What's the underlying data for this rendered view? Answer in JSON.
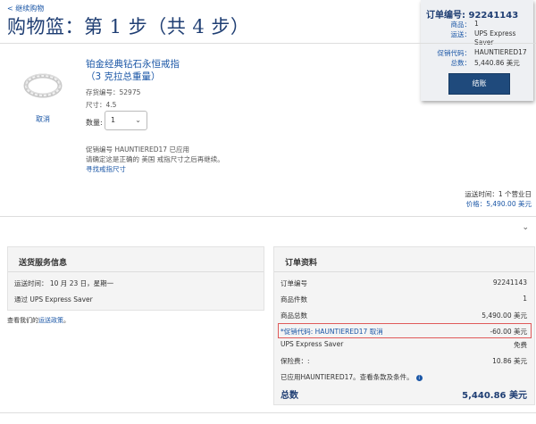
{
  "nav": {
    "back": "< 继续购物"
  },
  "page": {
    "title": "购物篮：第 1 步（共 4 步）"
  },
  "order_box": {
    "order_no_label": "订单编号:",
    "order_no": "92241143",
    "items_label": "商品：",
    "items": "1",
    "shipping_label": "运送：",
    "shipping": "UPS Express Saver",
    "promo_label": "促销代码：",
    "promo": "HAUNTIERED17",
    "total_label": "总数：",
    "total": "5,440.86 美元",
    "checkout": "结账"
  },
  "item": {
    "name_line1": "铂金经典钻石永恒戒指",
    "name_line2": "（3 克拉总重量）",
    "sku": "存货编号：52975",
    "size": "尺寸：4.5",
    "remove": "取消",
    "qty_label": "数量:",
    "qty": "1",
    "promo_applied": "促销编号 HAUNTIERED17 已应用",
    "size_note": "请确定这是正确的 美国 戒指尺寸之后再继续。",
    "find_size": "寻找戒指尺寸",
    "delivery": "运送时间：1 个营业日",
    "price": "价格：5,490.00 美元"
  },
  "shipping_info": {
    "title": "送货服务信息",
    "time": "运送时间： 10 月 23 日，星期一",
    "via": "通过 UPS Express Saver",
    "policy_prefix": "查看我们的",
    "policy_link": "运送政策",
    "policy_suffix": "。"
  },
  "order_summary": {
    "title": "订单资料",
    "rows": [
      {
        "label": "订单编号",
        "value": "92241143"
      },
      {
        "label": "商品件数",
        "value": "1"
      },
      {
        "label": "商品总数",
        "value": "5,490.00 美元"
      },
      {
        "label": "*促销代码: HAUNTIERED17 取消",
        "value": "-60.00 美元"
      },
      {
        "label": "UPS Express Saver",
        "value": "免费"
      },
      {
        "label": "保险费：:",
        "value": "10.86 美元"
      },
      {
        "label": "已应用HAUNTIERED17。查看条款及条件。",
        "value": ""
      }
    ],
    "total_label": "总数",
    "total_value": "5,440.86 美元"
  }
}
